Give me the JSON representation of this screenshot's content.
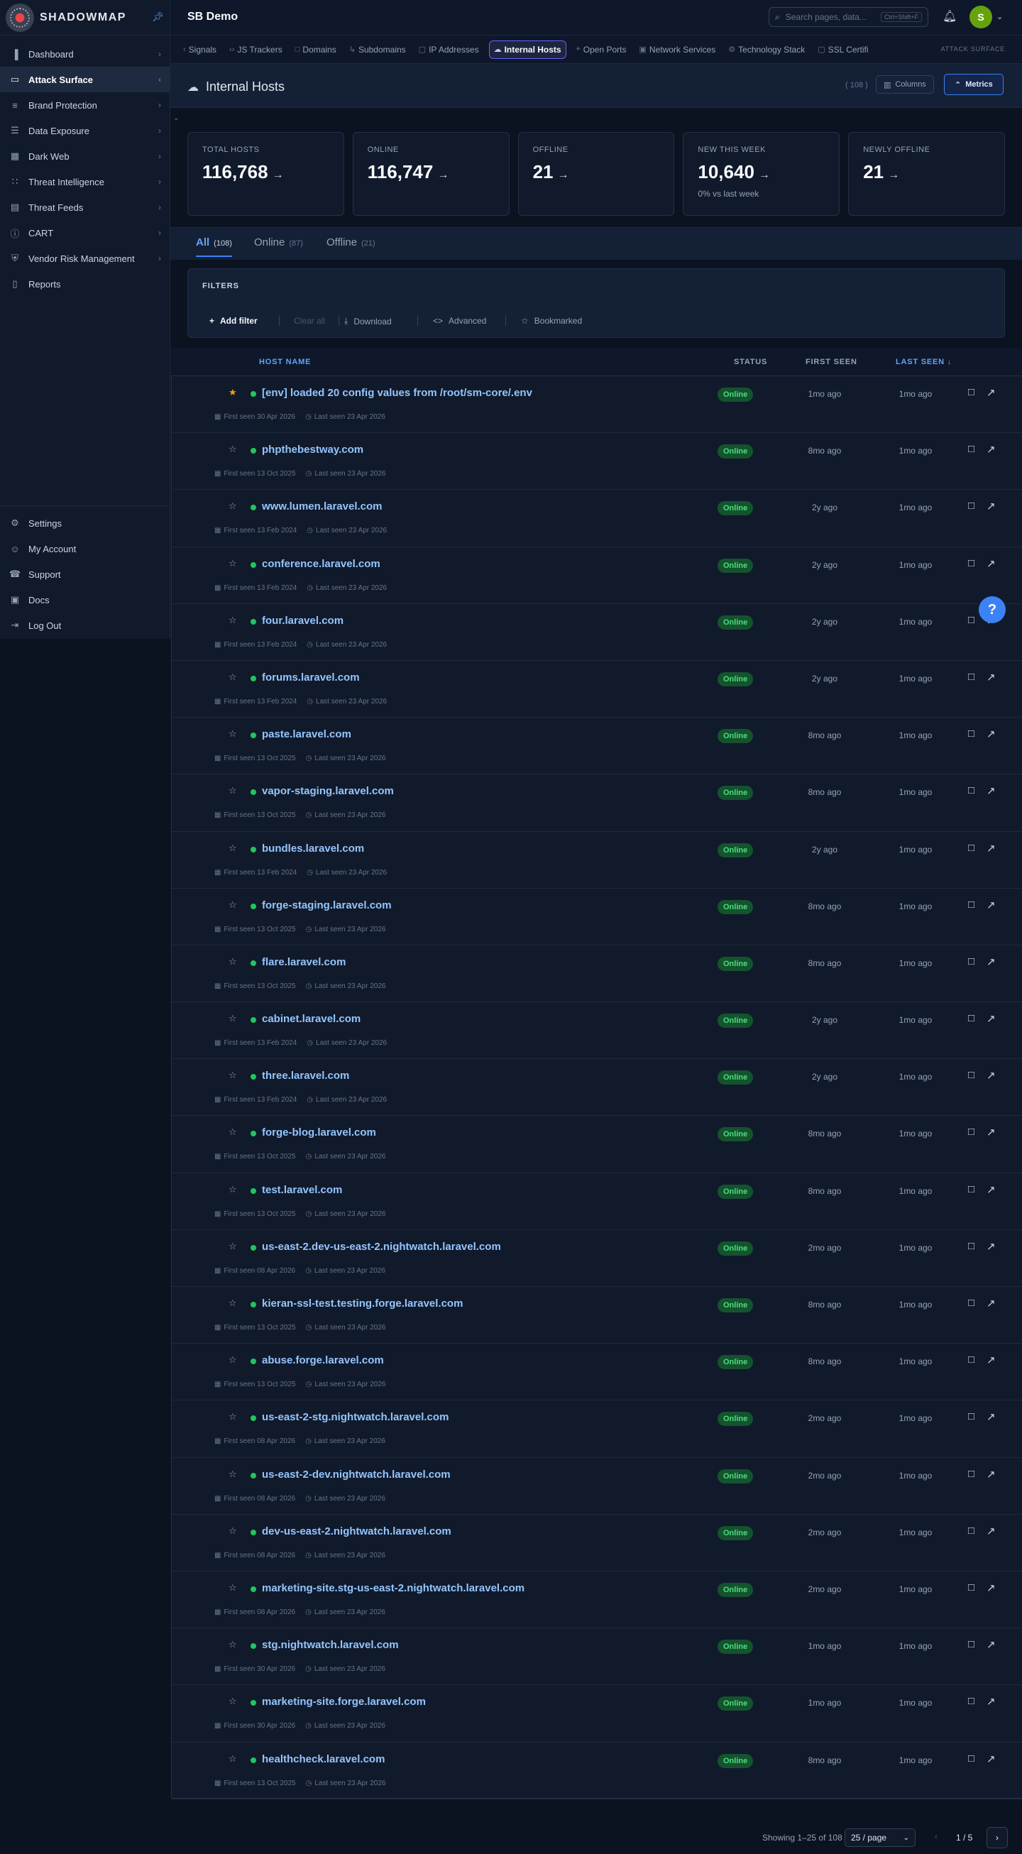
{
  "app": {
    "brand": "SHADOWMAP",
    "org": "SB Demo"
  },
  "search": {
    "placeholder": "Search pages, data...",
    "shortcut": "Ctrl+Shift+F"
  },
  "user": {
    "initial": "S"
  },
  "sidebar": {
    "items": [
      {
        "label": "Dashboard",
        "icon": "bar-chart-icon"
      },
      {
        "label": "Attack Surface",
        "icon": "laptop-icon",
        "active": true
      },
      {
        "label": "Brand Protection",
        "icon": "layers-icon"
      },
      {
        "label": "Data Exposure",
        "icon": "database-icon"
      },
      {
        "label": "Dark Web",
        "icon": "grid-icon"
      },
      {
        "label": "Threat Intelligence",
        "icon": "users-icon"
      },
      {
        "label": "Threat Feeds",
        "icon": "feed-icon"
      },
      {
        "label": "CART",
        "icon": "info-icon"
      },
      {
        "label": "Vendor Risk Management",
        "icon": "shield-icon"
      },
      {
        "label": "Reports",
        "icon": "document-icon"
      }
    ],
    "bottom": [
      {
        "label": "Settings",
        "icon": "gear-icon"
      },
      {
        "label": "My Account",
        "icon": "user-icon"
      },
      {
        "label": "Support",
        "icon": "support-icon"
      },
      {
        "label": "Docs",
        "icon": "book-icon"
      },
      {
        "label": "Log Out",
        "icon": "logout-icon"
      }
    ]
  },
  "tabs": {
    "items": [
      "Signals",
      "JS Trackers",
      "Domains",
      "Subdomains",
      "IP Addresses",
      "Internal Hosts",
      "Open Ports",
      "Network Services",
      "Technology Stack",
      "SSL Certifi"
    ],
    "active": "Internal Hosts",
    "section": "ATTACK SURFACE"
  },
  "page": {
    "title": "Internal Hosts",
    "count": "( 108 )",
    "columns_label": "Columns",
    "metrics_label": "Metrics"
  },
  "metrics": [
    {
      "label": "TOTAL HOSTS",
      "value": "116,768",
      "sub": ""
    },
    {
      "label": "ONLINE",
      "value": "116,747",
      "sub": ""
    },
    {
      "label": "OFFLINE",
      "value": "21",
      "sub": ""
    },
    {
      "label": "NEW THIS WEEK",
      "value": "10,640",
      "sub": "0% vs last week"
    },
    {
      "label": "NEWLY OFFLINE",
      "value": "21",
      "sub": ""
    }
  ],
  "filter_tabs": [
    {
      "label": "All",
      "count": "(108)"
    },
    {
      "label": "Online",
      "count": "(87)"
    },
    {
      "label": "Offline",
      "count": "(21)"
    }
  ],
  "filters": {
    "title": "FILTERS",
    "add": "Add filter",
    "clear": "Clear all",
    "download": "Download",
    "advanced": "Advanced",
    "bookmarked": "Bookmarked"
  },
  "table": {
    "headers": {
      "host": "HOST NAME",
      "status": "STATUS",
      "first": "FIRST SEEN",
      "last": "LAST SEEN"
    },
    "rows": [
      {
        "host": "[env] loaded 20 config values from /root/sm-core/.env",
        "first_meta": "First seen 30 Apr 2026",
        "last_meta": "Last seen 23 Apr 2026",
        "status": "Online",
        "first": "1mo ago",
        "last": "1mo ago",
        "starred": true
      },
      {
        "host": "phpthebestway.com",
        "first_meta": "First seen 13 Oct 2025",
        "last_meta": "Last seen 23 Apr 2026",
        "status": "Online",
        "first": "8mo ago",
        "last": "1mo ago"
      },
      {
        "host": "www.lumen.laravel.com",
        "first_meta": "First seen 13 Feb 2024",
        "last_meta": "Last seen 23 Apr 2026",
        "status": "Online",
        "first": "2y ago",
        "last": "1mo ago"
      },
      {
        "host": "conference.laravel.com",
        "first_meta": "First seen 13 Feb 2024",
        "last_meta": "Last seen 23 Apr 2026",
        "status": "Online",
        "first": "2y ago",
        "last": "1mo ago"
      },
      {
        "host": "four.laravel.com",
        "first_meta": "First seen 13 Feb 2024",
        "last_meta": "Last seen 23 Apr 2026",
        "status": "Online",
        "first": "2y ago",
        "last": "1mo ago"
      },
      {
        "host": "forums.laravel.com",
        "first_meta": "First seen 13 Feb 2024",
        "last_meta": "Last seen 23 Apr 2026",
        "status": "Online",
        "first": "2y ago",
        "last": "1mo ago"
      },
      {
        "host": "paste.laravel.com",
        "first_meta": "First seen 13 Oct 2025",
        "last_meta": "Last seen 23 Apr 2026",
        "status": "Online",
        "first": "8mo ago",
        "last": "1mo ago"
      },
      {
        "host": "vapor-staging.laravel.com",
        "first_meta": "First seen 13 Oct 2025",
        "last_meta": "Last seen 23 Apr 2026",
        "status": "Online",
        "first": "8mo ago",
        "last": "1mo ago"
      },
      {
        "host": "bundles.laravel.com",
        "first_meta": "First seen 13 Feb 2024",
        "last_meta": "Last seen 23 Apr 2026",
        "status": "Online",
        "first": "2y ago",
        "last": "1mo ago"
      },
      {
        "host": "forge-staging.laravel.com",
        "first_meta": "First seen 13 Oct 2025",
        "last_meta": "Last seen 23 Apr 2026",
        "status": "Online",
        "first": "8mo ago",
        "last": "1mo ago"
      },
      {
        "host": "flare.laravel.com",
        "first_meta": "First seen 13 Oct 2025",
        "last_meta": "Last seen 23 Apr 2026",
        "status": "Online",
        "first": "8mo ago",
        "last": "1mo ago"
      },
      {
        "host": "cabinet.laravel.com",
        "first_meta": "First seen 13 Feb 2024",
        "last_meta": "Last seen 23 Apr 2026",
        "status": "Online",
        "first": "2y ago",
        "last": "1mo ago"
      },
      {
        "host": "three.laravel.com",
        "first_meta": "First seen 13 Feb 2024",
        "last_meta": "Last seen 23 Apr 2026",
        "status": "Online",
        "first": "2y ago",
        "last": "1mo ago"
      },
      {
        "host": "forge-blog.laravel.com",
        "first_meta": "First seen 13 Oct 2025",
        "last_meta": "Last seen 23 Apr 2026",
        "status": "Online",
        "first": "8mo ago",
        "last": "1mo ago"
      },
      {
        "host": "test.laravel.com",
        "first_meta": "First seen 13 Oct 2025",
        "last_meta": "Last seen 23 Apr 2026",
        "status": "Online",
        "first": "8mo ago",
        "last": "1mo ago"
      },
      {
        "host": "us-east-2.dev-us-east-2.nightwatch.laravel.com",
        "first_meta": "First seen 08 Apr 2026",
        "last_meta": "Last seen 23 Apr 2026",
        "status": "Online",
        "first": "2mo ago",
        "last": "1mo ago"
      },
      {
        "host": "kieran-ssl-test.testing.forge.laravel.com",
        "first_meta": "First seen 13 Oct 2025",
        "last_meta": "Last seen 23 Apr 2026",
        "status": "Online",
        "first": "8mo ago",
        "last": "1mo ago"
      },
      {
        "host": "abuse.forge.laravel.com",
        "first_meta": "First seen 13 Oct 2025",
        "last_meta": "Last seen 23 Apr 2026",
        "status": "Online",
        "first": "8mo ago",
        "last": "1mo ago"
      },
      {
        "host": "us-east-2-stg.nightwatch.laravel.com",
        "first_meta": "First seen 08 Apr 2026",
        "last_meta": "Last seen 23 Apr 2026",
        "status": "Online",
        "first": "2mo ago",
        "last": "1mo ago"
      },
      {
        "host": "us-east-2-dev.nightwatch.laravel.com",
        "first_meta": "First seen 08 Apr 2026",
        "last_meta": "Last seen 23 Apr 2026",
        "status": "Online",
        "first": "2mo ago",
        "last": "1mo ago"
      },
      {
        "host": "dev-us-east-2.nightwatch.laravel.com",
        "first_meta": "First seen 08 Apr 2026",
        "last_meta": "Last seen 23 Apr 2026",
        "status": "Online",
        "first": "2mo ago",
        "last": "1mo ago"
      },
      {
        "host": "marketing-site.stg-us-east-2.nightwatch.laravel.com",
        "first_meta": "First seen 08 Apr 2026",
        "last_meta": "Last seen 23 Apr 2026",
        "status": "Online",
        "first": "2mo ago",
        "last": "1mo ago"
      },
      {
        "host": "stg.nightwatch.laravel.com",
        "first_meta": "First seen 30 Apr 2026",
        "last_meta": "Last seen 23 Apr 2026",
        "status": "Online",
        "first": "1mo ago",
        "last": "1mo ago"
      },
      {
        "host": "marketing-site.forge.laravel.com",
        "first_meta": "First seen 30 Apr 2026",
        "last_meta": "Last seen 23 Apr 2026",
        "status": "Online",
        "first": "1mo ago",
        "last": "1mo ago"
      },
      {
        "host": "healthcheck.laravel.com",
        "first_meta": "First seen 13 Oct 2025",
        "last_meta": "Last seen 23 Apr 2026",
        "status": "Online",
        "first": "8mo ago",
        "last": "1mo ago"
      }
    ]
  },
  "help": {
    "label": "?"
  },
  "pagination": {
    "info": "Showing 1–25 of 108",
    "per_page": "25 / page",
    "page": "1 / 5"
  },
  "colors": {
    "accent": "#3b82f6",
    "online": "#22c55e",
    "star": "#f59e0b",
    "link": "#93c5fd"
  }
}
